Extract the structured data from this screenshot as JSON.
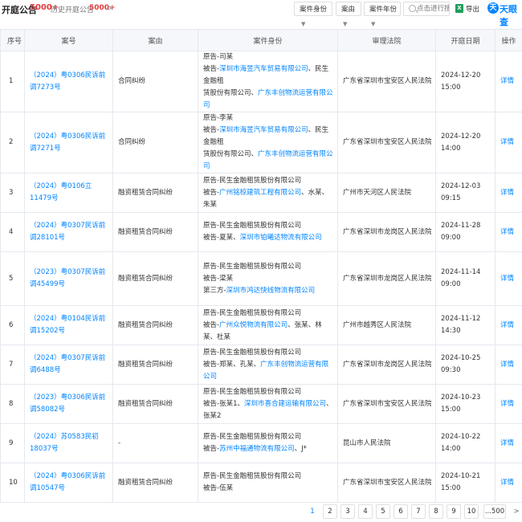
{
  "header": {
    "title": "开庭公告",
    "count": "5000+",
    "history_label": "历史开庭公告",
    "history_count": "5000+",
    "history_arrow": ">"
  },
  "filters": [
    {
      "label": "案件身份"
    },
    {
      "label": "案由"
    },
    {
      "label": "案件年份"
    }
  ],
  "search": {
    "placeholder": "点击进行搜索"
  },
  "export": {
    "icon_text": "X",
    "label": "导出"
  },
  "brand": {
    "mark": "天",
    "name": "天眼查"
  },
  "table": {
    "headers": {
      "seq": "序号",
      "case_no": "案号",
      "cause": "案由",
      "identity": "案件身份",
      "court": "审理法院",
      "date": "开庭日期",
      "action": "操作"
    },
    "rows": [
      {
        "seq": "1",
        "case_no": "（2024）粤0306民诉前调7273号",
        "cause": "合同纠纷",
        "identity": [
          [
            {
              "t": "原告-司某",
              "link": false
            }
          ],
          [
            {
              "t": "被告-",
              "link": false
            },
            {
              "t": "深圳市海昱汽车贸易有限公司",
              "link": true
            },
            {
              "t": "、民生金融租",
              "link": false
            }
          ],
          [
            {
              "t": "赁股份有限公司、",
              "link": false
            },
            {
              "t": "广东丰创物流运营有限公司",
              "link": true
            }
          ]
        ],
        "court": "广东省深圳市宝安区人民法院",
        "date": "2024-12-20 15:00",
        "action": "详情"
      },
      {
        "seq": "2",
        "case_no": "（2024）粤0306民诉前调7271号",
        "cause": "合同纠纷",
        "identity": [
          [
            {
              "t": "原告-李某",
              "link": false
            }
          ],
          [
            {
              "t": "被告-",
              "link": false
            },
            {
              "t": "深圳市海昱汽车贸易有限公司",
              "link": true
            },
            {
              "t": "、民生金融租",
              "link": false
            }
          ],
          [
            {
              "t": "赁股份有限公司、",
              "link": false
            },
            {
              "t": "广东丰创物流运营有限公司",
              "link": true
            }
          ]
        ],
        "court": "广东省深圳市宝安区人民法院",
        "date": "2024-12-20 14:00",
        "action": "详情"
      },
      {
        "seq": "3",
        "case_no": "（2024）粤0106立11479号",
        "cause": "融资租赁合同纠纷",
        "identity": [
          [
            {
              "t": "原告-民生金融租赁股份有限公司",
              "link": false
            }
          ],
          [
            {
              "t": "被告-",
              "link": false
            },
            {
              "t": "广州铭椋建筑工程有限公司",
              "link": true
            },
            {
              "t": "、水某、朱某",
              "link": false
            }
          ]
        ],
        "court": "广州市天河区人民法院",
        "date": "2024-12-03 09:15",
        "action": "详情"
      },
      {
        "seq": "4",
        "case_no": "（2024）粤0307民诉前调28101号",
        "cause": "融资租赁合同纠纷",
        "identity": [
          [
            {
              "t": "原告-民生金融租赁股份有限公司",
              "link": false
            }
          ],
          [
            {
              "t": "被告-夏某、",
              "link": false
            },
            {
              "t": "深圳市铂曦达物流有限公司",
              "link": true
            }
          ]
        ],
        "court": "广东省深圳市龙岗区人民法院",
        "date": "2024-11-28 09:00",
        "action": "详情"
      },
      {
        "seq": "5",
        "case_no": "（2023）粤0307民诉前调45499号",
        "cause": "融资租赁合同纠纷",
        "identity": [
          [
            {
              "t": "原告-民生金融租赁股份有限公司",
              "link": false
            }
          ],
          [
            {
              "t": "被告-梁某",
              "link": false
            }
          ],
          [
            {
              "t": "第三方-",
              "link": false
            },
            {
              "t": "深圳市鸿达快线物流有限公司",
              "link": true
            }
          ]
        ],
        "court": "广东省深圳市龙岗区人民法院",
        "date": "2024-11-14 09:00",
        "action": "详情"
      },
      {
        "seq": "6",
        "case_no": "（2024）粤0104民诉前调15202号",
        "cause": "融资租赁合同纠纷",
        "identity": [
          [
            {
              "t": "原告-民生金融租赁股份有限公司",
              "link": false
            }
          ],
          [
            {
              "t": "被告-",
              "link": false
            },
            {
              "t": "广州众悦物流有限公司",
              "link": true
            },
            {
              "t": "、张某、林某、杜某",
              "link": false
            }
          ]
        ],
        "court": "广州市越秀区人民法院",
        "date": "2024-11-12 14:30",
        "action": "详情"
      },
      {
        "seq": "7",
        "case_no": "（2024）粤0307民诉前调6488号",
        "cause": "融资租赁合同纠纷",
        "identity": [
          [
            {
              "t": "原告-民生金融租赁股份有限公司",
              "link": false
            }
          ],
          [
            {
              "t": "被告-郑某、孔某、",
              "link": false
            },
            {
              "t": "广东丰创物流运营有限公司",
              "link": true
            }
          ]
        ],
        "court": "广东省深圳市龙岗区人民法院",
        "date": "2024-10-25 09:30",
        "action": "详情"
      },
      {
        "seq": "8",
        "case_no": "（2023）粤0306民诉前调58082号",
        "cause": "融资租赁合同纠纷",
        "identity": [
          [
            {
              "t": "原告-民生金融租赁股份有限公司",
              "link": false
            }
          ],
          [
            {
              "t": "被告-张某1、",
              "link": false
            },
            {
              "t": "深圳市喜合建运输有限公司",
              "link": true
            },
            {
              "t": "、张某2",
              "link": false
            }
          ]
        ],
        "court": "广东省深圳市宝安区人民法院",
        "date": "2024-10-23 15:00",
        "action": "详情"
      },
      {
        "seq": "9",
        "case_no": "（2024）苏0583民初18037号",
        "cause": "-",
        "identity": [
          [
            {
              "t": "原告-民生金融租赁股份有限公司",
              "link": false
            }
          ],
          [
            {
              "t": "被告-",
              "link": false
            },
            {
              "t": "苏州中福通物流有限公司",
              "link": true
            },
            {
              "t": "、J*",
              "link": false
            }
          ]
        ],
        "court": "昆山市人民法院",
        "date": "2024-10-22 14:00",
        "action": "详情"
      },
      {
        "seq": "10",
        "case_no": "（2024）粤0306民诉前调10547号",
        "cause": "融资租赁合同纠纷",
        "identity": [
          [
            {
              "t": "原告-民生金融租赁股份有限公司",
              "link": false
            }
          ],
          [
            {
              "t": "被告-伍某",
              "link": false
            }
          ]
        ],
        "court": "广东省深圳市宝安区人民法院",
        "date": "2024-10-21 15:00",
        "action": "详情"
      }
    ]
  },
  "pagination": {
    "pages": [
      "1",
      "2",
      "3",
      "4",
      "5",
      "6",
      "7",
      "8",
      "9",
      "10",
      "...500"
    ],
    "current": "1",
    "next": ">"
  }
}
